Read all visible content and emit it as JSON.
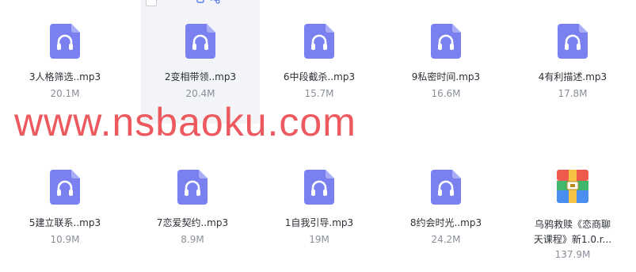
{
  "files": [
    {
      "name": "3人格筛选..mp3",
      "size": "20.1M",
      "icon": "audio-file-icon"
    },
    {
      "name": "2变相带领..mp3",
      "size": "20.4M",
      "icon": "audio-file-icon"
    },
    {
      "name": "6中段截杀..mp3",
      "size": "15.7M",
      "icon": "audio-file-icon"
    },
    {
      "name": "9私密时间.mp3",
      "size": "16.6M",
      "icon": "audio-file-icon"
    },
    {
      "name": "4有利描述.mp3",
      "size": "17.8M",
      "icon": "audio-file-icon"
    },
    {
      "name": "5建立联系..mp3",
      "size": "10.9M",
      "icon": "audio-file-icon"
    },
    {
      "name": "7恋爱契约..mp3",
      "size": "8.9M",
      "icon": "audio-file-icon"
    },
    {
      "name": "1自我引导.mp3",
      "size": "19M",
      "icon": "audio-file-icon"
    },
    {
      "name": "8约会时光..mp3",
      "size": "24.2M",
      "icon": "audio-file-icon"
    },
    {
      "name_line1": "乌鸦救赎《恋商聊",
      "name_line2": "天课程》新1.0.r...",
      "size": "137.9M",
      "icon": "archive-file-icon"
    }
  ],
  "watermark": "www.nsbaoku.com",
  "colors": {
    "audio_icon": "#7b80f0",
    "watermark": "#ec5a5f",
    "hover_bg": "#f2f4f8"
  }
}
